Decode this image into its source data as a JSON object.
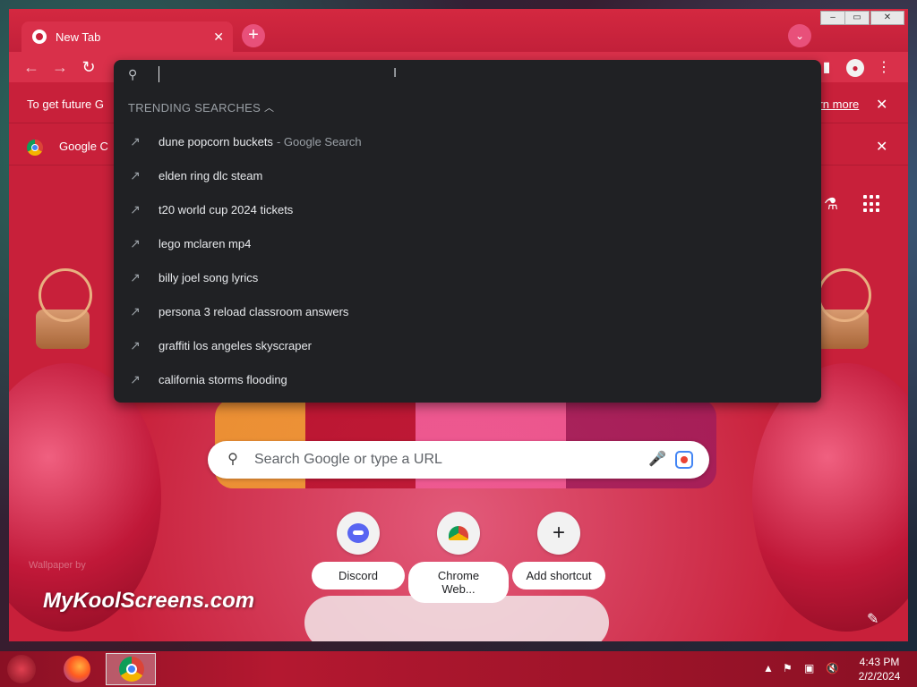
{
  "browser": {
    "tab": {
      "title": "New Tab",
      "close": "✕"
    },
    "new_tab": "+",
    "tab_search": "⌄",
    "window_controls": {
      "minimize": "–",
      "maximize": "▭",
      "close": "✕"
    },
    "toolbar": {
      "back": "←",
      "forward": "→",
      "reload": "↻",
      "side_panel": "▮",
      "profile": "●",
      "menu": "⋮"
    }
  },
  "infobars": [
    {
      "text": "To get future G",
      "link": "earn more",
      "close": "✕"
    },
    {
      "text": "Google C",
      "close": "✕"
    }
  ],
  "omnibox": {
    "query": "",
    "caret": "I",
    "search_icon": "⚲",
    "trending_header": "TRENDING SEARCHES",
    "chevron": "︿",
    "suggestions": [
      {
        "text": "dune popcorn buckets",
        "sub": "- Google Search"
      },
      {
        "text": "elden ring dlc steam",
        "sub": ""
      },
      {
        "text": "t20 world cup 2024 tickets",
        "sub": ""
      },
      {
        "text": "lego mclaren mp4",
        "sub": ""
      },
      {
        "text": "billy joel song lyrics",
        "sub": ""
      },
      {
        "text": "persona 3 reload classroom answers",
        "sub": ""
      },
      {
        "text": "graffiti los angeles skyscraper",
        "sub": ""
      },
      {
        "text": "california storms flooding",
        "sub": ""
      }
    ],
    "trend_icon": "↗"
  },
  "ntp": {
    "search_placeholder": "Search Google or type a URL",
    "search_icon": "⚲",
    "mic_icon": "🎤",
    "labs_icon": "⚗",
    "shortcuts": [
      {
        "label": "Discord"
      },
      {
        "label": "Chrome Web..."
      },
      {
        "label": "Add shortcut",
        "glyph": "+"
      }
    ],
    "watermark_small": "Wallpaper by",
    "watermark": "MyKoolScreens.com",
    "customize_icon": "✎"
  },
  "taskbar": {
    "tray_chevron": "▲",
    "tray_flag": "⚑",
    "tray_network": "▣",
    "tray_volume": "🔇",
    "time": "4:43 PM",
    "date": "2/2/2024"
  }
}
